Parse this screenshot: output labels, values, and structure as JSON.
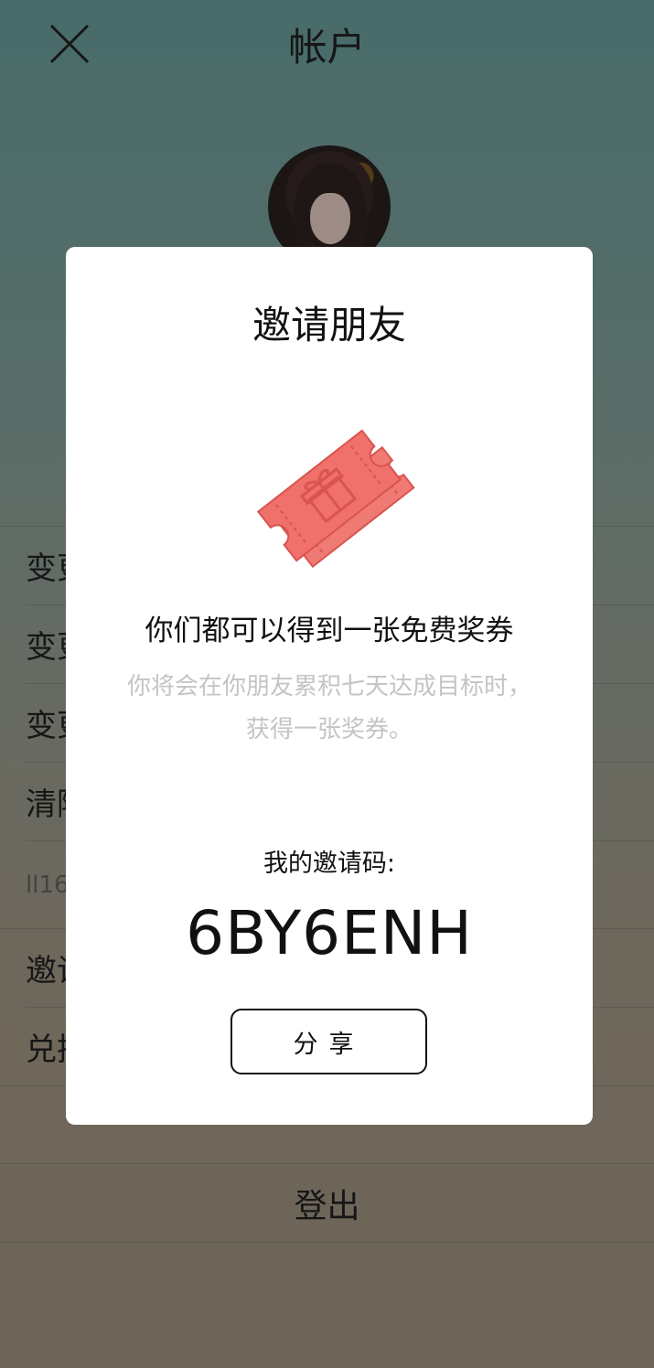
{
  "header": {
    "title": "帐户"
  },
  "menu": {
    "rows": [
      {
        "label": "变更"
      },
      {
        "label": "变更"
      },
      {
        "label": "变更"
      },
      {
        "label": "清除"
      },
      {
        "label": "ll16"
      },
      {
        "label": "邀请"
      },
      {
        "label": "兑换"
      }
    ],
    "logout_label": "登出"
  },
  "modal": {
    "title": "邀请朋友",
    "headline": "你们都可以得到一张免费奖券",
    "description_line1": "你将会在你朋友累积七天达成目标时，",
    "description_line2": "获得一张奖券。",
    "code_label": "我的邀请码:",
    "invite_code": "6BY6ENH",
    "share_label": "分享"
  },
  "colors": {
    "ticket": "#f0706b",
    "ticket_line": "#d9534f"
  }
}
